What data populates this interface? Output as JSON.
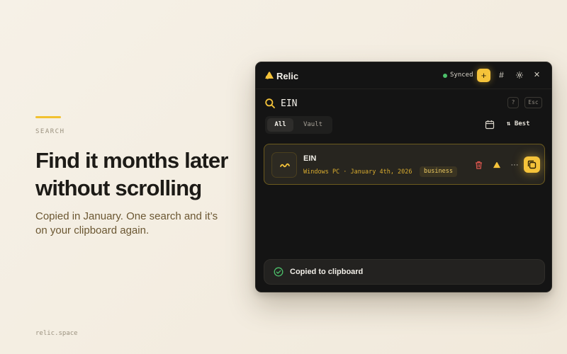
{
  "hero": {
    "eyebrow": "SEARCH",
    "headline_line1": "Find it months later",
    "headline_line2": "without scrolling",
    "sub_line1": "Copied in January. One search and it’s",
    "sub_line2": "on your clipboard again.",
    "footer": "relic.space"
  },
  "app": {
    "title": "Relic",
    "sync_status": "Synced",
    "add_symbol": "+",
    "hash_symbol": "#",
    "close_symbol": "✕",
    "colors": {
      "accent": "#f5c33a",
      "synced": "#4cc06a",
      "delete": "#e0574f"
    }
  },
  "search": {
    "value": "EIN",
    "help_key": "?",
    "escape_key": "Esc"
  },
  "filters": {
    "tabs": [
      {
        "label": "All",
        "active": true
      },
      {
        "label": "Vault",
        "active": false
      }
    ],
    "sort_label": "Best"
  },
  "results": [
    {
      "title": "EIN",
      "meta": "Windows PC · January 4th, 2026",
      "tag": "business",
      "more_symbol": "···"
    }
  ],
  "toast": {
    "message": "Copied to clipboard"
  }
}
